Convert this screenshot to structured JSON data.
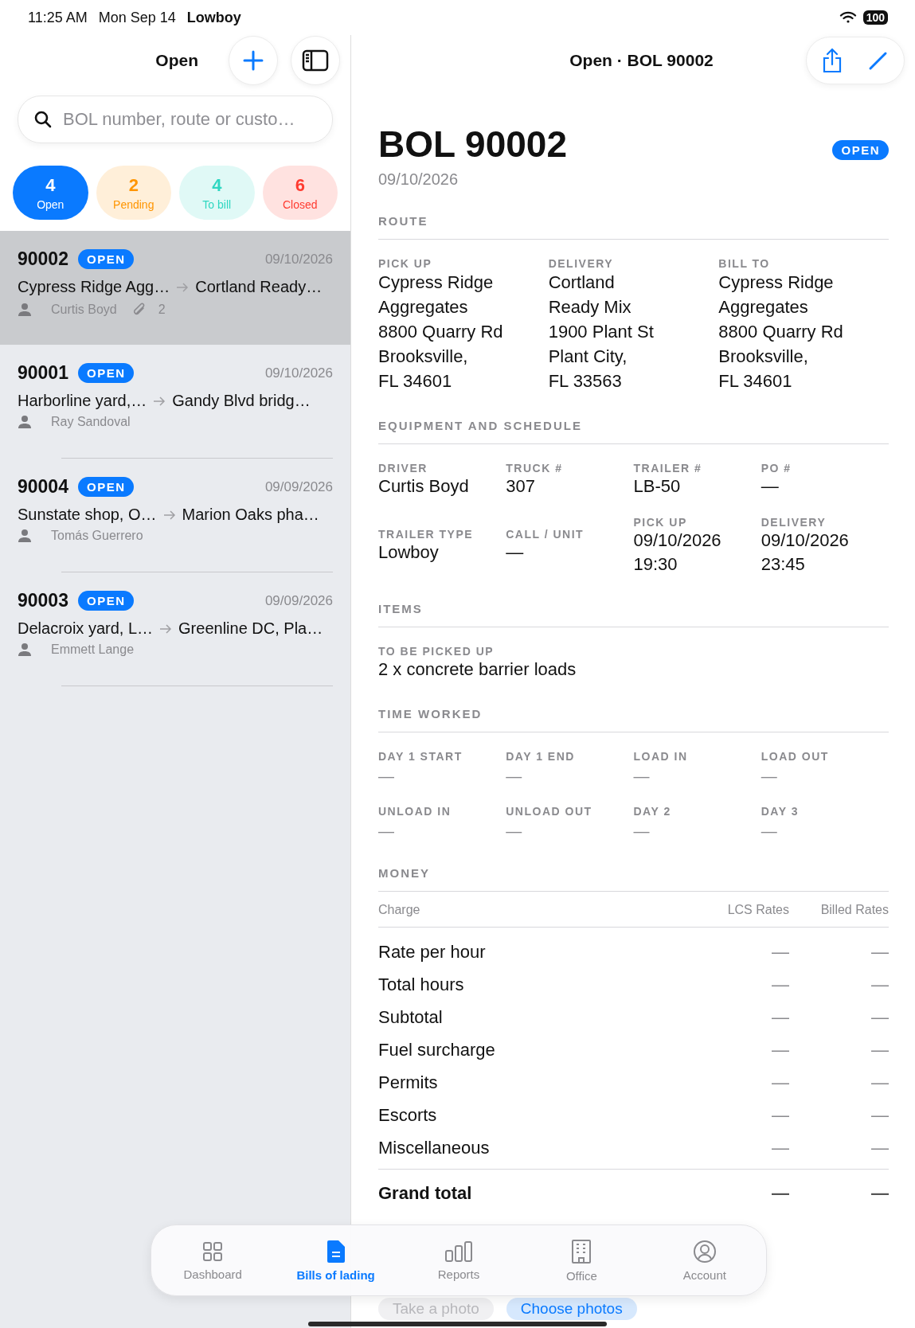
{
  "status_bar": {
    "time": "11:25 AM",
    "date": "Mon Sep 14",
    "carrier": "Lowboy",
    "battery": "100"
  },
  "sidebar": {
    "title": "Open",
    "search": {
      "placeholder": "BOL number, route or custo…"
    },
    "filters": [
      {
        "count": "4",
        "label": "Open",
        "color": "#0a7aff",
        "selected": true
      },
      {
        "count": "2",
        "label": "Pending",
        "color": "#ff9500",
        "selected": false
      },
      {
        "count": "4",
        "label": "To bill",
        "color": "#2fd7c1",
        "selected": false
      },
      {
        "count": "6",
        "label": "Closed",
        "color": "#ff3b30",
        "selected": false
      }
    ],
    "bols": [
      {
        "number": "90002",
        "status": "OPEN",
        "date": "09/10/2026",
        "from": "Cypress Ridge Agg…",
        "to": "Cortland Ready…",
        "driver": "Curtis Boyd",
        "attachments": "2",
        "selected": true
      },
      {
        "number": "90001",
        "status": "OPEN",
        "date": "09/10/2026",
        "from": "Harborline yard,…",
        "to": "Gandy Blvd bridg…",
        "driver": "Ray Sandoval",
        "selected": false
      },
      {
        "number": "90004",
        "status": "OPEN",
        "date": "09/09/2026",
        "from": "Sunstate shop, O…",
        "to": "Marion Oaks pha…",
        "driver": "Tomás Guerrero",
        "selected": false
      },
      {
        "number": "90003",
        "status": "OPEN",
        "date": "09/09/2026",
        "from": "Delacroix yard, L…",
        "to": "Greenline DC, Pla…",
        "driver": "Emmett Lange",
        "selected": false
      }
    ]
  },
  "detail": {
    "nav_title": "Open · BOL 90002",
    "title": "BOL 90002",
    "status": "OPEN",
    "date": "09/10/2026",
    "route": {
      "heading": "ROUTE",
      "columns": [
        {
          "label": "PICK UP",
          "lines": [
            "Cypress Ridge",
            "Aggregates",
            "8800 Quarry Rd",
            "Brooksville,",
            "FL 34601"
          ]
        },
        {
          "label": "DELIVERY",
          "lines": [
            "Cortland",
            "Ready Mix",
            "1900 Plant St",
            "Plant City,",
            "FL 33563"
          ]
        },
        {
          "label": "BILL TO",
          "lines": [
            "Cypress Ridge",
            "Aggregates",
            "8800 Quarry Rd",
            "Brooksville,",
            "FL 34601"
          ]
        }
      ]
    },
    "equipment": {
      "heading": "EQUIPMENT AND SCHEDULE",
      "fields": [
        {
          "label": "DRIVER",
          "lines": [
            "Curtis Boyd"
          ]
        },
        {
          "label": "TRUCK #",
          "lines": [
            "307"
          ]
        },
        {
          "label": "TRAILER #",
          "lines": [
            "LB-50"
          ]
        },
        {
          "label": "PO #",
          "lines": [
            "—"
          ]
        },
        {
          "label": "TRAILER TYPE",
          "lines": [
            "Lowboy"
          ]
        },
        {
          "label": "CALL / UNIT",
          "lines": [
            "—"
          ]
        },
        {
          "label": "PICK UP",
          "lines": [
            "09/10/2026",
            "19:30"
          ]
        },
        {
          "label": "DELIVERY",
          "lines": [
            "09/10/2026",
            "23:45"
          ]
        }
      ]
    },
    "items": {
      "heading": "ITEMS",
      "label": "TO BE PICKED UP",
      "value": "2 x concrete barrier loads"
    },
    "time_worked": {
      "heading": "TIME WORKED",
      "fields": [
        {
          "label": "DAY 1 START",
          "value": "—"
        },
        {
          "label": "DAY 1 END",
          "value": "—"
        },
        {
          "label": "LOAD IN",
          "value": "—"
        },
        {
          "label": "LOAD OUT",
          "value": "—"
        },
        {
          "label": "UNLOAD IN",
          "value": "—"
        },
        {
          "label": "UNLOAD OUT",
          "value": "—"
        },
        {
          "label": "DAY 2",
          "value": "—"
        },
        {
          "label": "DAY 3",
          "value": "—"
        }
      ]
    },
    "money": {
      "heading": "MONEY",
      "columns": [
        "Charge",
        "LCS Rates",
        "Billed Rates"
      ],
      "rows": [
        {
          "charge": "Rate per hour",
          "lcs": "—",
          "billed": "—"
        },
        {
          "charge": "Total hours",
          "lcs": "—",
          "billed": "—"
        },
        {
          "charge": "Subtotal",
          "lcs": "—",
          "billed": "—"
        },
        {
          "charge": "Fuel surcharge",
          "lcs": "—",
          "billed": "—"
        },
        {
          "charge": "Permits",
          "lcs": "—",
          "billed": "—"
        },
        {
          "charge": "Escorts",
          "lcs": "—",
          "billed": "—"
        },
        {
          "charge": "Miscellaneous",
          "lcs": "—",
          "billed": "—"
        }
      ],
      "total": {
        "charge": "Grand total",
        "lcs": "—",
        "billed": "—"
      }
    },
    "photo_buttons": [
      {
        "label": "Take a photo",
        "disabled": true
      },
      {
        "label": "Choose photos",
        "disabled": false
      }
    ]
  },
  "tab_bar": [
    {
      "label": "Dashboard",
      "kind": "grid",
      "selected": false
    },
    {
      "label": "Bills of lading",
      "kind": "document",
      "selected": true
    },
    {
      "label": "Reports",
      "kind": "chart",
      "selected": false
    },
    {
      "label": "Office",
      "kind": "building",
      "selected": false
    },
    {
      "label": "Account",
      "kind": "person",
      "selected": false
    }
  ]
}
